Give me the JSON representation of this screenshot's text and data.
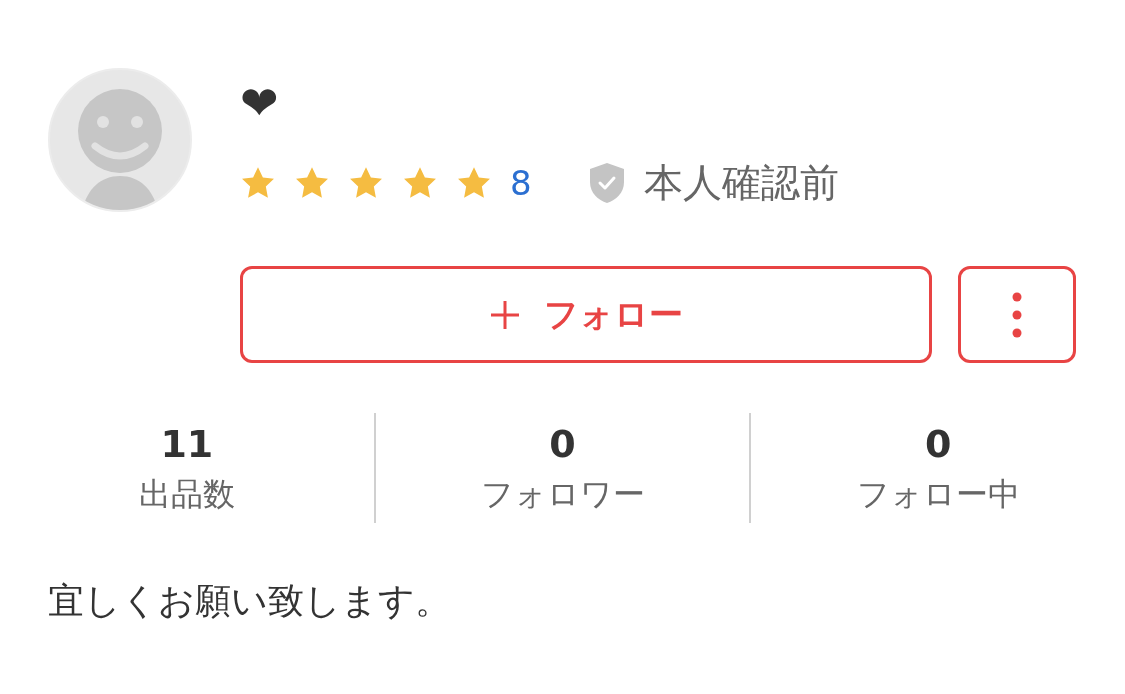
{
  "profile": {
    "name": "❤",
    "stars": 5,
    "rating_count": "8",
    "verification": "本人確認前"
  },
  "actions": {
    "follow": "フォロー"
  },
  "stats": [
    {
      "value": "11",
      "label": "出品数"
    },
    {
      "value": "0",
      "label": "フォロワー"
    },
    {
      "value": "0",
      "label": "フォロー中"
    }
  ],
  "bio": "宜しくお願い致します。"
}
